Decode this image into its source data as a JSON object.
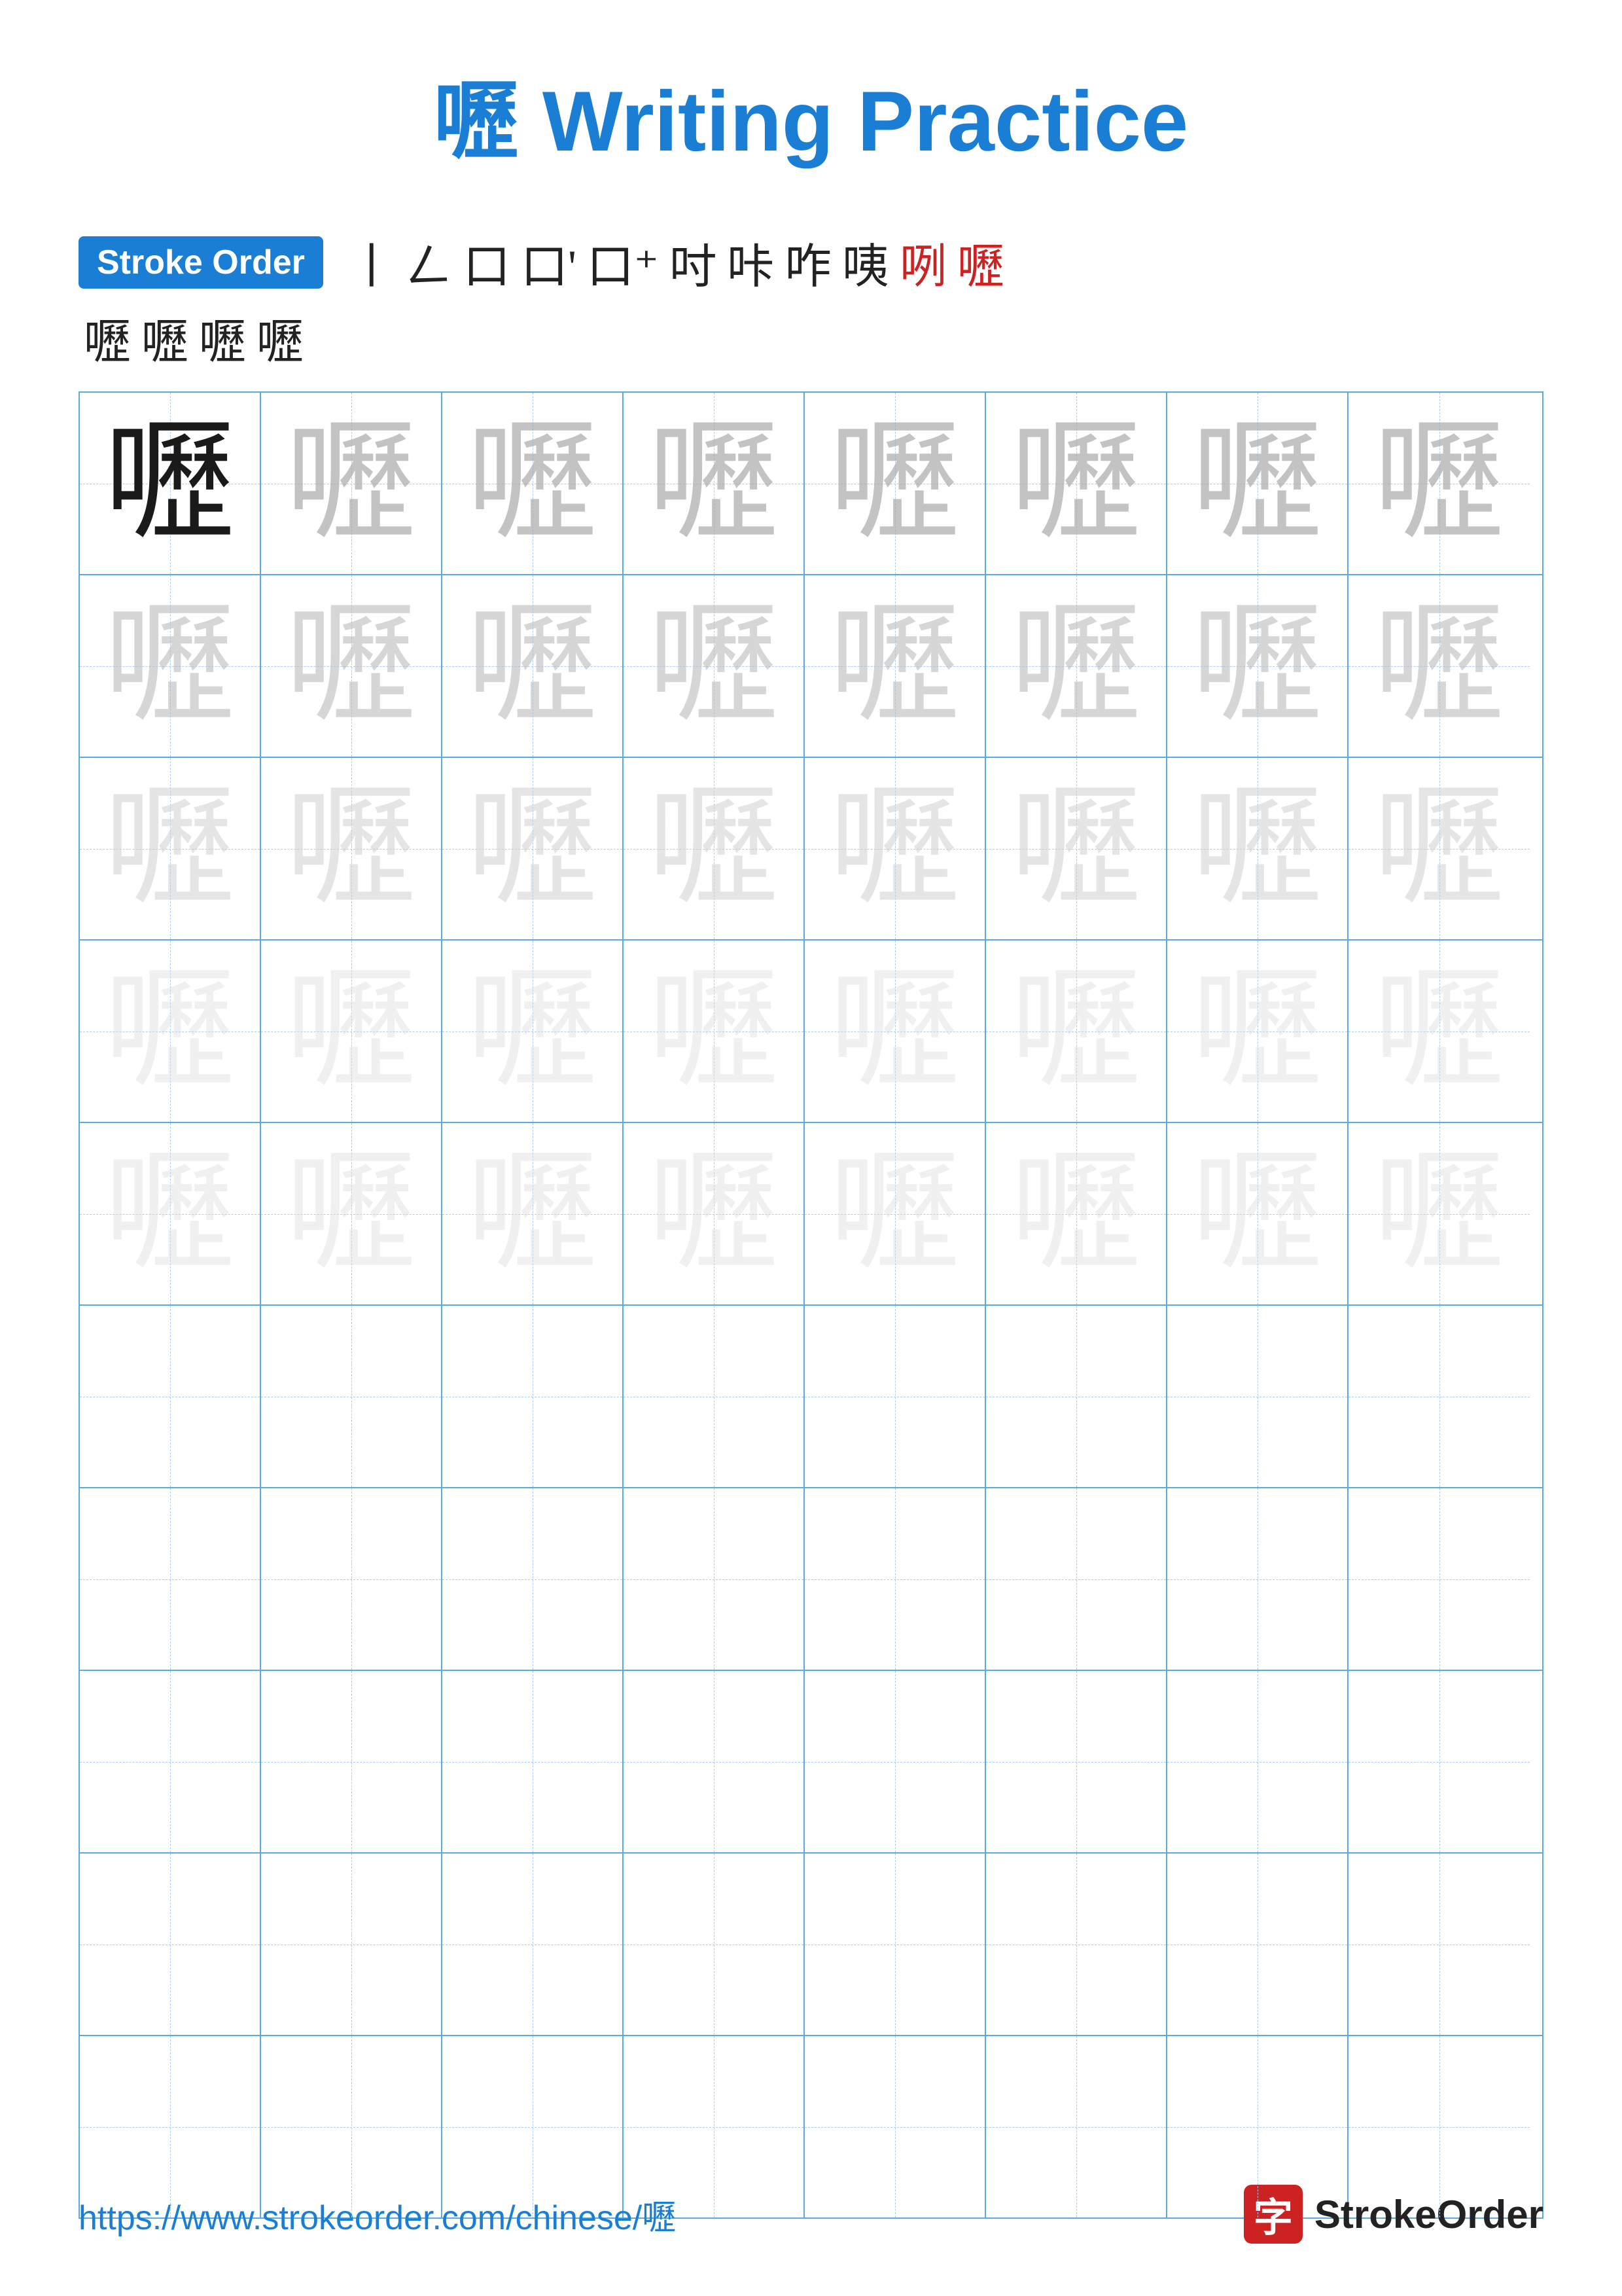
{
  "page": {
    "title": "嚦 Writing Practice",
    "title_char": "嚦",
    "title_suffix": " Writing Practice",
    "stroke_order_label": "Stroke Order",
    "stroke_sequence_line1": [
      "丨",
      "𠃋",
      "口",
      "口",
      "口⁺",
      "吋",
      "咔",
      "咋",
      "咦",
      "咧",
      "嚦"
    ],
    "stroke_sequence_line2": [
      "嚦",
      "嚦",
      "嚦",
      "嚦"
    ],
    "character": "嚦",
    "rows": 10,
    "cols": 8,
    "practice_rows": [
      [
        1,
        0.7,
        0.7,
        0.7,
        0.7,
        0.7,
        0.7,
        0.7
      ],
      [
        0.6,
        0.6,
        0.6,
        0.6,
        0.6,
        0.6,
        0.6,
        0.6
      ],
      [
        0.45,
        0.45,
        0.45,
        0.45,
        0.45,
        0.45,
        0.45,
        0.45
      ],
      [
        0.3,
        0.3,
        0.3,
        0.3,
        0.3,
        0.3,
        0.3,
        0.3
      ],
      [
        0.2,
        0.2,
        0.2,
        0.2,
        0.2,
        0.2,
        0.2,
        0.2
      ],
      [
        0,
        0,
        0,
        0,
        0,
        0,
        0,
        0
      ],
      [
        0,
        0,
        0,
        0,
        0,
        0,
        0,
        0
      ],
      [
        0,
        0,
        0,
        0,
        0,
        0,
        0,
        0
      ],
      [
        0,
        0,
        0,
        0,
        0,
        0,
        0,
        0
      ],
      [
        0,
        0,
        0,
        0,
        0,
        0,
        0,
        0
      ]
    ],
    "footer_url": "https://www.strokeorder.com/chinese/嚦",
    "brand_char": "字",
    "brand_name": "StrokeOrder"
  }
}
